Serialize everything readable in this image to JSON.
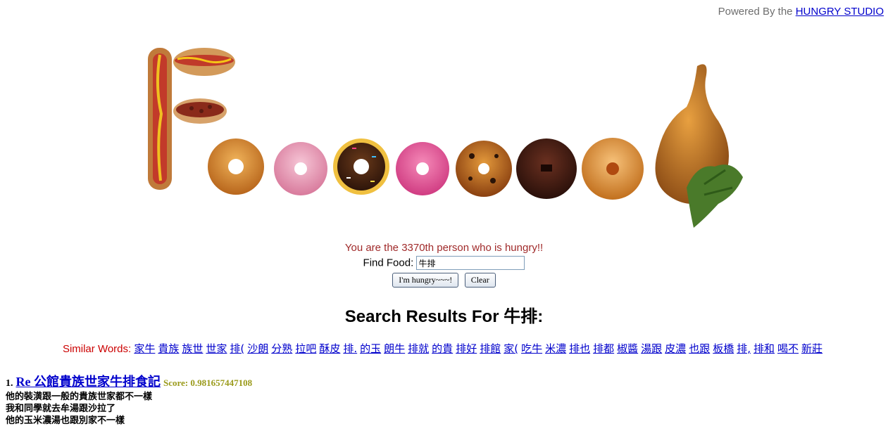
{
  "header": {
    "powered_prefix": "Powered By the",
    "studio_link": "HUNGRY STUDIO"
  },
  "visitor_message": "You are the 3370th person who is hungry!!",
  "search": {
    "label": "Find Food:",
    "value": "牛排",
    "hungry_button": "I'm hungry~~~!",
    "clear_button": "Clear"
  },
  "results": {
    "title": "Search Results For 牛排:",
    "similar_label": "Similar Words:",
    "similar_words": [
      "家牛",
      "貴族",
      "族世",
      "世家",
      "排(",
      "沙朗",
      "分熟",
      "拉吧",
      "酥皮",
      "排.",
      "的玉",
      "朗牛",
      "排就",
      "的貴",
      "排好",
      "排館",
      "家(",
      "吃牛",
      "米濃",
      "排也",
      "排都",
      "椒醬",
      "湯跟",
      "皮濃",
      "也跟",
      "板橋",
      "排,",
      "排和",
      "喝不",
      "新莊"
    ],
    "items": [
      {
        "number": "1.",
        "title": "Re 公館貴族世家牛排食記",
        "score": "Score: 0.981657447108",
        "lines": [
          "他的裝潢跟一般的貴族世家都不一樣",
          "我和同學就去牟湯跟沙拉了",
          "他的玉米濃湯也跟別家不一樣"
        ]
      }
    ]
  },
  "colors": {
    "link": "#0000cc",
    "visitor": "#a02a2a",
    "similar_label": "#cc0000",
    "score": "#9a9a1a"
  }
}
